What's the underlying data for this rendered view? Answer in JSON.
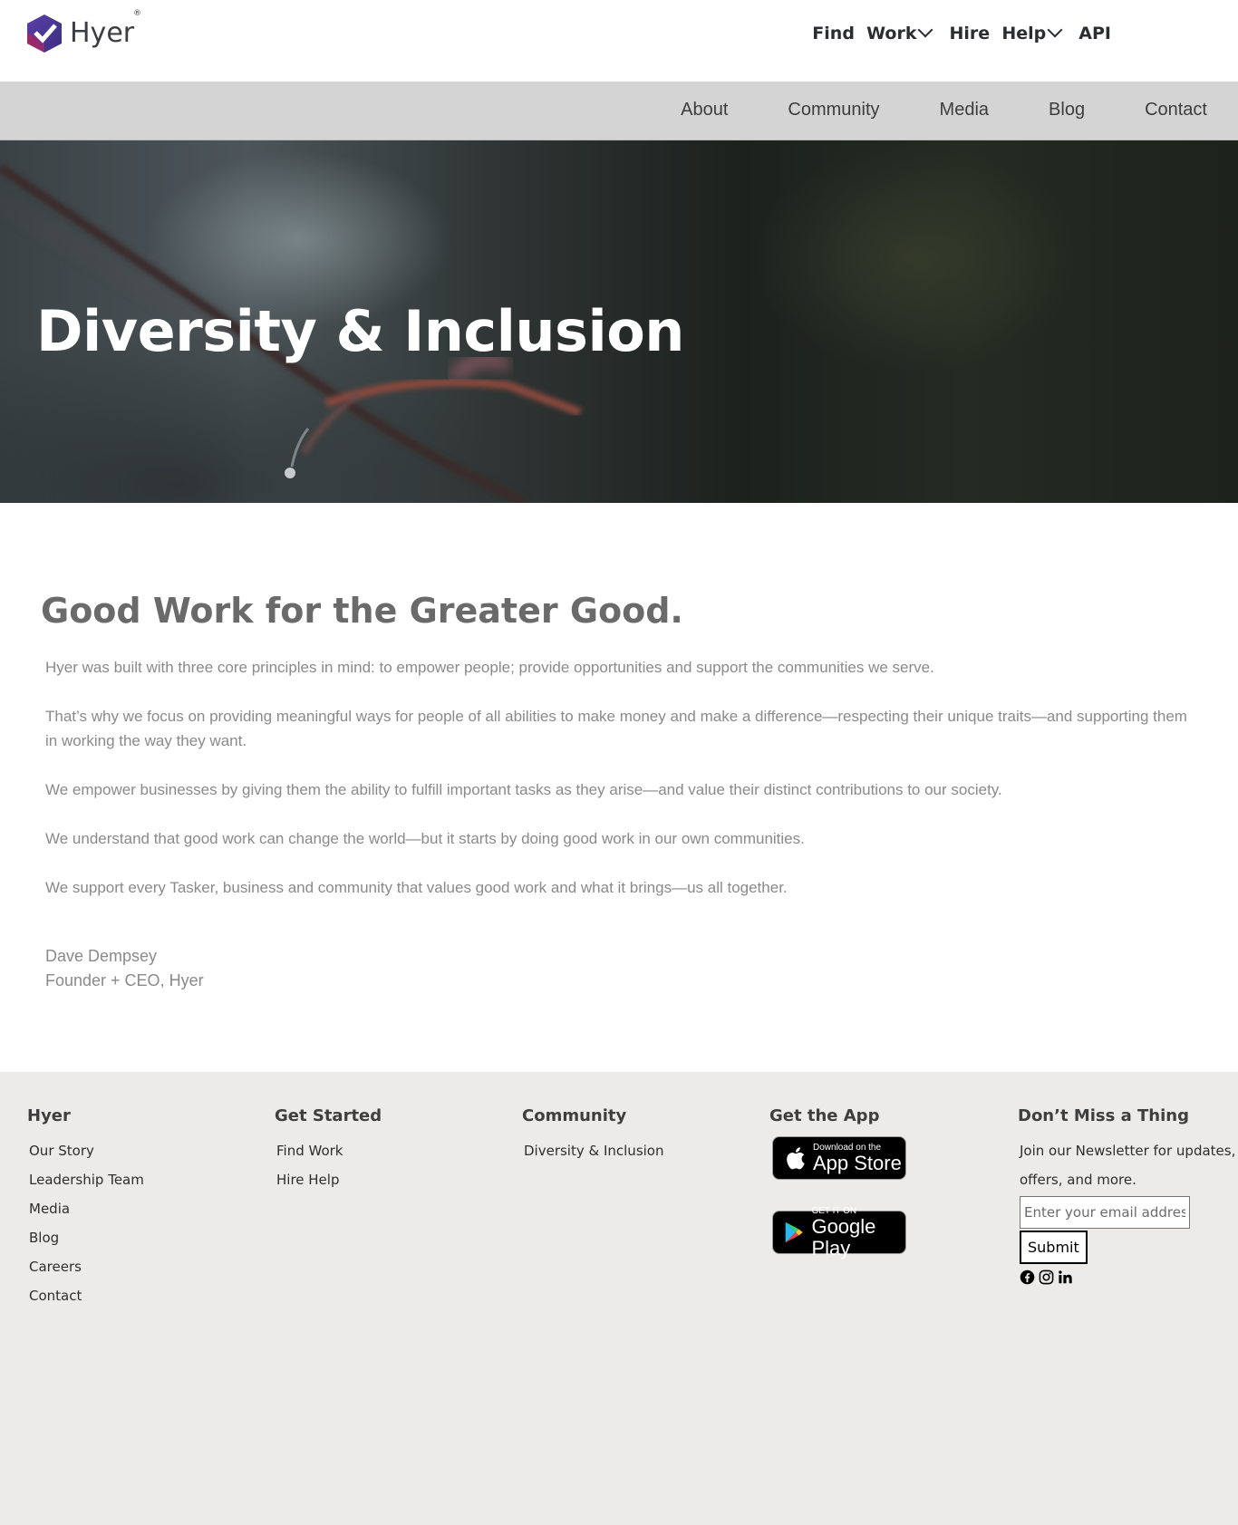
{
  "brand": {
    "name": "Hyer",
    "reg": "®"
  },
  "topnav": [
    {
      "label": "Find  Work",
      "has_menu": true
    },
    {
      "label": "Hire  Help",
      "has_menu": true
    },
    {
      "label": "API",
      "has_menu": false
    }
  ],
  "subnav": [
    "About",
    "Community",
    "Media",
    "Blog",
    "Contact"
  ],
  "hero": {
    "title": "Diversity & Inclusion"
  },
  "main": {
    "heading": "Good Work for the Greater Good.",
    "paragraphs": [
      "Hyer was built with three core principles in mind: to empower people; provide opportunities and support the communities we serve.",
      "That’s why we focus on providing meaningful ways for people of all abilities to make money and make a difference—respecting their unique traits—and supporting them in working the way they want.",
      "We empower businesses by giving them the ability to fulfill important tasks as they arise—and value their distinct contributions to our society.",
      "We understand that good work can change the world—but it starts by doing good work in our own communities.",
      "We support every Tasker, business and community that values good work and what it brings—us all together."
    ],
    "signature": {
      "name": "Dave Dempsey",
      "title": "Founder + CEO, Hyer"
    }
  },
  "footer": {
    "hyer": {
      "heading": "Hyer",
      "links": [
        "Our Story",
        "Leadership Team",
        "Media",
        "Blog",
        "Careers",
        "Contact"
      ]
    },
    "get_started": {
      "heading": "Get Started",
      "links": [
        "Find Work",
        "Hire Help"
      ]
    },
    "community": {
      "heading": "Community",
      "links": [
        "Diversity & Inclusion"
      ]
    },
    "get_app": {
      "heading": "Get the App",
      "app_store": {
        "small": "Download on the",
        "big": "App Store"
      },
      "google_play": {
        "small": "GET IT ON",
        "big": "Google Play"
      }
    },
    "newsletter": {
      "heading": "Don’t Miss a Thing",
      "text": "Join our Newsletter for updates, offers, and more.",
      "email_placeholder": "Enter your email address",
      "submit_label": "Submit"
    },
    "social_icons": [
      "facebook-icon",
      "instagram-icon",
      "linkedin-icon"
    ]
  },
  "colors": {
    "subnav_bg": "#d4d4d4",
    "footer_bg": "#ecebea",
    "heading_gray": "#6a6a6a",
    "text_gray": "#8a8a8a"
  }
}
